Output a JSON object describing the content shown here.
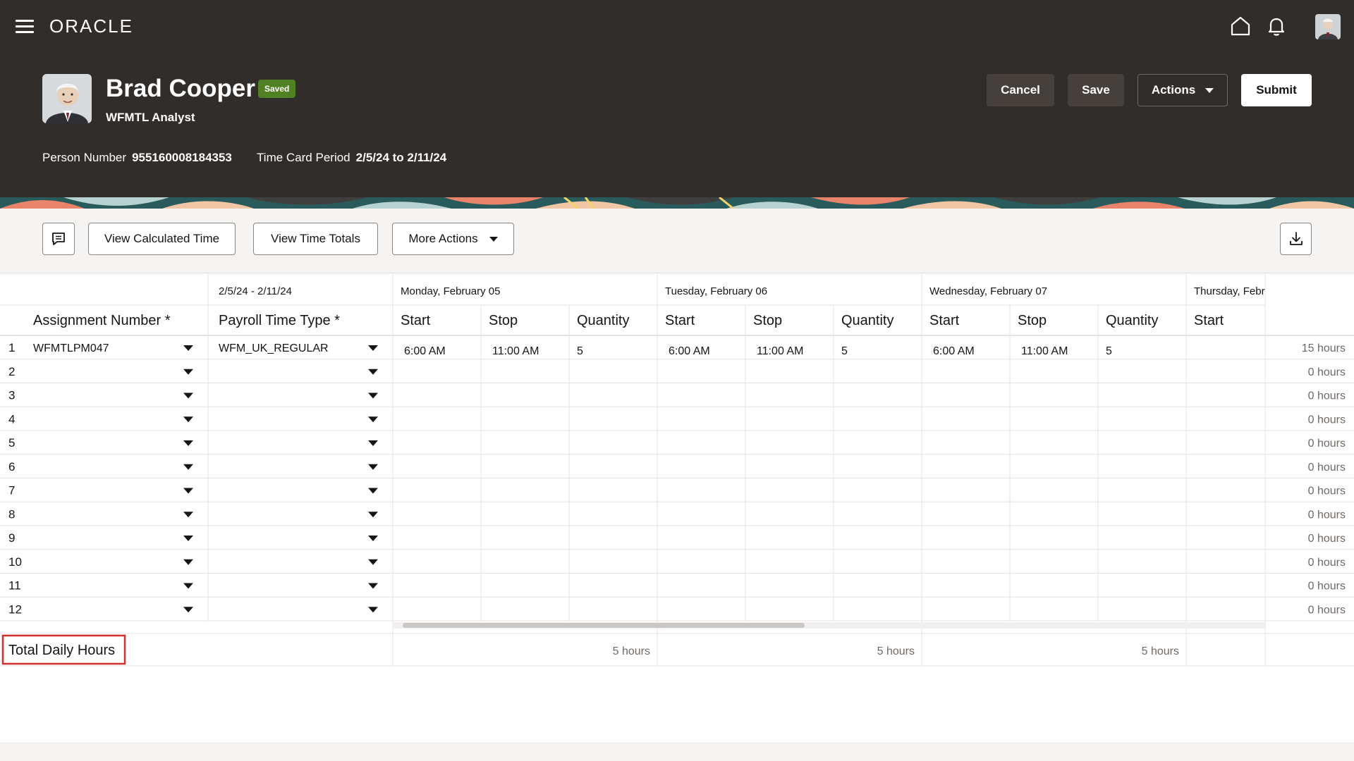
{
  "header": {
    "logo": "ORACLE",
    "name": "Brad Cooper",
    "status": "Saved",
    "title": "WFMTL Analyst",
    "person_number_label": "Person Number",
    "person_number": "955160008184353",
    "period_label": "Time Card Period",
    "period": "2/5/24 to 2/11/24",
    "buttons": {
      "cancel": "Cancel",
      "save": "Save",
      "actions": "Actions",
      "submit": "Submit"
    },
    "icons": [
      "hamburger-menu-icon",
      "home-icon",
      "bell-icon",
      "user-avatar"
    ]
  },
  "toolbar": {
    "comment_icon": "comment-icon",
    "view_calculated": "View Calculated Time",
    "view_totals": "View Time Totals",
    "more_actions": "More Actions",
    "download_icon": "download-icon"
  },
  "grid": {
    "period_header": "2/5/24 - 2/11/24",
    "days": [
      "Monday, February 05",
      "Tuesday, February 06",
      "Wednesday, February 07",
      "Thursday, Febr"
    ],
    "columns": {
      "assignment": "Assignment Number *",
      "payroll": "Payroll Time Type *",
      "start": "Start",
      "stop": "Stop",
      "quantity": "Quantity"
    },
    "rows": [
      {
        "num": "1",
        "assignment": "WFMTLPM047",
        "payroll": "WFM_UK_REGULAR",
        "days": [
          [
            "6:00 AM",
            "11:00 AM",
            "5"
          ],
          [
            "6:00 AM",
            "11:00 AM",
            "5"
          ],
          [
            "6:00 AM",
            "11:00 AM",
            "5"
          ]
        ],
        "total": "15 hours"
      },
      {
        "num": "2",
        "assignment": "",
        "payroll": "",
        "days": [],
        "total": "0 hours"
      },
      {
        "num": "3",
        "assignment": "",
        "payroll": "",
        "days": [],
        "total": "0 hours"
      },
      {
        "num": "4",
        "assignment": "",
        "payroll": "",
        "days": [],
        "total": "0 hours"
      },
      {
        "num": "5",
        "assignment": "",
        "payroll": "",
        "days": [],
        "total": "0 hours"
      },
      {
        "num": "6",
        "assignment": "",
        "payroll": "",
        "days": [],
        "total": "0 hours"
      },
      {
        "num": "7",
        "assignment": "",
        "payroll": "",
        "days": [],
        "total": "0 hours"
      },
      {
        "num": "8",
        "assignment": "",
        "payroll": "",
        "days": [],
        "total": "0 hours"
      },
      {
        "num": "9",
        "assignment": "",
        "payroll": "",
        "days": [],
        "total": "0 hours"
      },
      {
        "num": "10",
        "assignment": "",
        "payroll": "",
        "days": [],
        "total": "0 hours"
      },
      {
        "num": "11",
        "assignment": "",
        "payroll": "",
        "days": [],
        "total": "0 hours"
      },
      {
        "num": "12",
        "assignment": "",
        "payroll": "",
        "days": [],
        "total": "0 hours"
      }
    ],
    "footer_label": "Total Daily Hours",
    "footer_totals": [
      "5 hours",
      "5 hours",
      "5 hours"
    ]
  },
  "colors": {
    "header_bg": "#312d2a",
    "saved_badge": "#508223",
    "highlight_border": "#d32f2f"
  }
}
